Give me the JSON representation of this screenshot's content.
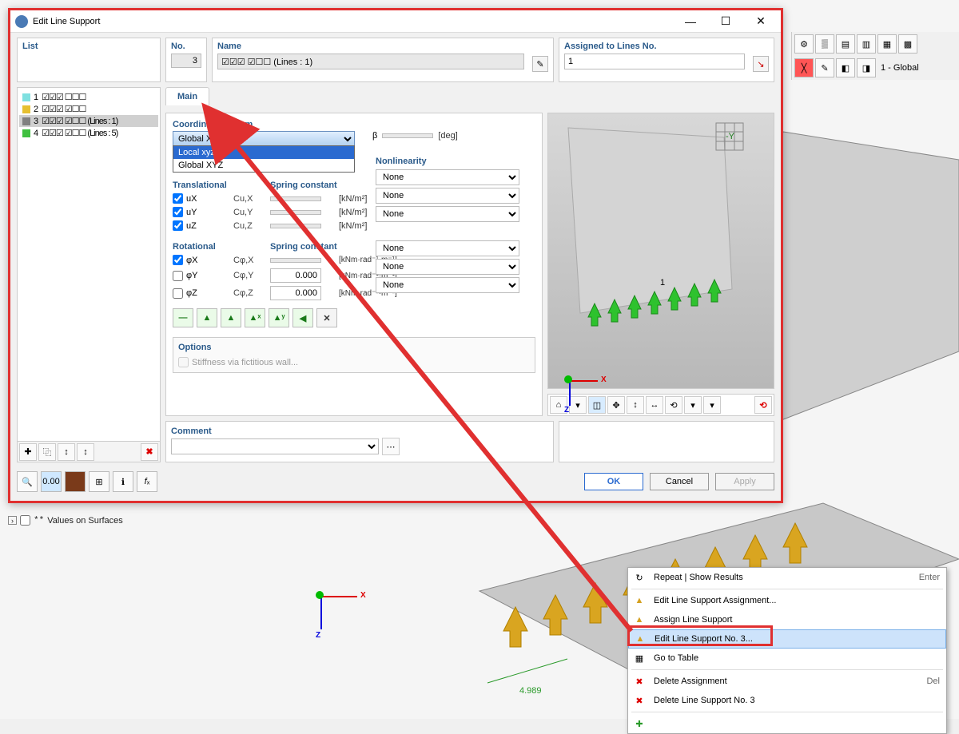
{
  "dialog": {
    "title": "Edit Line Support",
    "list_header": "List",
    "no_header": "No.",
    "no_value": "3",
    "name_header": "Name",
    "name_value": "☑☑☑ ☑☐☐ (Lines : 1)",
    "assigned_header": "Assigned to Lines No.",
    "assigned_value": "1",
    "tab_main": "Main",
    "list_items": [
      {
        "idx": "1",
        "color": "#7fe0e0",
        "label": "☑☑☑ ☐☐☐"
      },
      {
        "idx": "2",
        "color": "#e6c030",
        "label": "☑☑☑ ☑☐☐"
      },
      {
        "idx": "3",
        "color": "#808080",
        "label": "☑☑☑ ☑☐☐ (Lines : 1)"
      },
      {
        "idx": "4",
        "color": "#40c040",
        "label": "☑☑☑ ☑☐☐ (Lines : 5)"
      }
    ],
    "coord_section": "Coordinate System",
    "coord_value": "Global XYZ",
    "coord_options": [
      "Local xyz",
      "Global XYZ"
    ],
    "beta_label": "β",
    "beta_unit": "[deg]",
    "trans_header": "Translational",
    "spring_header": "Spring constant",
    "nonlin_header": "Nonlinearity",
    "rot_header": "Rotational",
    "rows_trans": [
      {
        "chk": true,
        "name": "uX",
        "sc": "Cu,X",
        "unit": "[kN/m²]",
        "nl": "None"
      },
      {
        "chk": true,
        "name": "uY",
        "sc": "Cu,Y",
        "unit": "[kN/m²]",
        "nl": "None"
      },
      {
        "chk": true,
        "name": "uZ",
        "sc": "Cu,Z",
        "unit": "[kN/m²]",
        "nl": "None"
      }
    ],
    "rows_rot": [
      {
        "chk": true,
        "name": "φX",
        "sc": "Cφ,X",
        "val": "",
        "unit": "[kNm·rad⁻¹·m⁻¹]",
        "nl": "None"
      },
      {
        "chk": false,
        "name": "φY",
        "sc": "Cφ,Y",
        "val": "0.000",
        "unit": "[kNm·rad⁻¹·m⁻¹]",
        "nl": "None"
      },
      {
        "chk": false,
        "name": "φZ",
        "sc": "Cφ,Z",
        "val": "0.000",
        "unit": "[kNm·rad⁻¹·m⁻¹]",
        "nl": "None"
      }
    ],
    "options_header": "Options",
    "options_stiffness": "Stiffness via fictitious wall...",
    "comment_header": "Comment",
    "btn_ok": "OK",
    "btn_cancel": "Cancel",
    "btn_apply": "Apply"
  },
  "ctx": {
    "repeat": "Repeat | Show Results",
    "repeat_accel": "Enter",
    "edit_assign": "Edit Line Support Assignment...",
    "assign": "Assign Line Support",
    "edit_no": "Edit Line Support No. 3...",
    "goto": "Go to Table",
    "del_assign": "Delete Assignment",
    "del_accel": "Del",
    "del_support": "Delete Line Support No. 3"
  },
  "tree": {
    "values_surfaces": "Values on Surfaces"
  },
  "viewport": {
    "dim": "4.989",
    "node": "1",
    "combo": "1 - Global"
  },
  "axes": {
    "x": "X",
    "z": "Z",
    "y": "-Y"
  }
}
